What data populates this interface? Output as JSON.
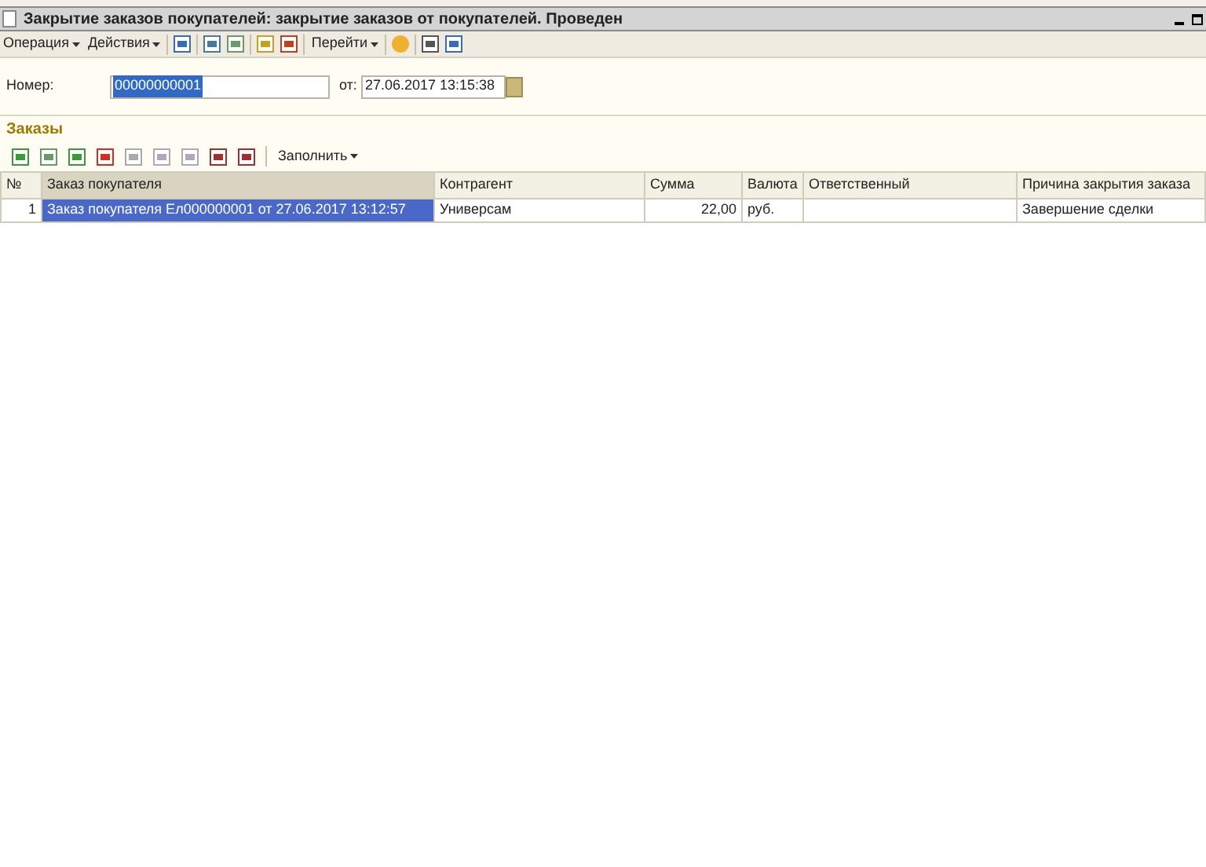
{
  "window": {
    "title": "Закрытие заказов покупателей: закрытие заказов от покупателей. Проведен"
  },
  "toolbar": {
    "menus": [
      "Операция",
      "Действия",
      "Перейти"
    ]
  },
  "header": {
    "number_label": "Номер:",
    "number_value": "00000000001",
    "date_label": "от:",
    "date_value": "27.06.2017 13:15:38"
  },
  "orders": {
    "title": "Заказы",
    "fill_button": "Заполнить",
    "columns": [
      {
        "label": "№",
        "selected": false
      },
      {
        "label": "Заказ покупателя",
        "selected": true
      },
      {
        "label": "Контрагент",
        "selected": false
      },
      {
        "label": "Сумма",
        "selected": false
      },
      {
        "label": "Валюта",
        "selected": false
      },
      {
        "label": "Ответственный",
        "selected": false
      },
      {
        "label": "Причина закрытия заказа",
        "selected": false
      }
    ],
    "rows": [
      {
        "cells": [
          "1",
          "Заказ покупателя Ел000000001 от 27.06.2017 13:12:57",
          "Универсам",
          "22,00",
          "руб.",
          "",
          "Завершение сделки"
        ],
        "selected": true
      }
    ]
  }
}
